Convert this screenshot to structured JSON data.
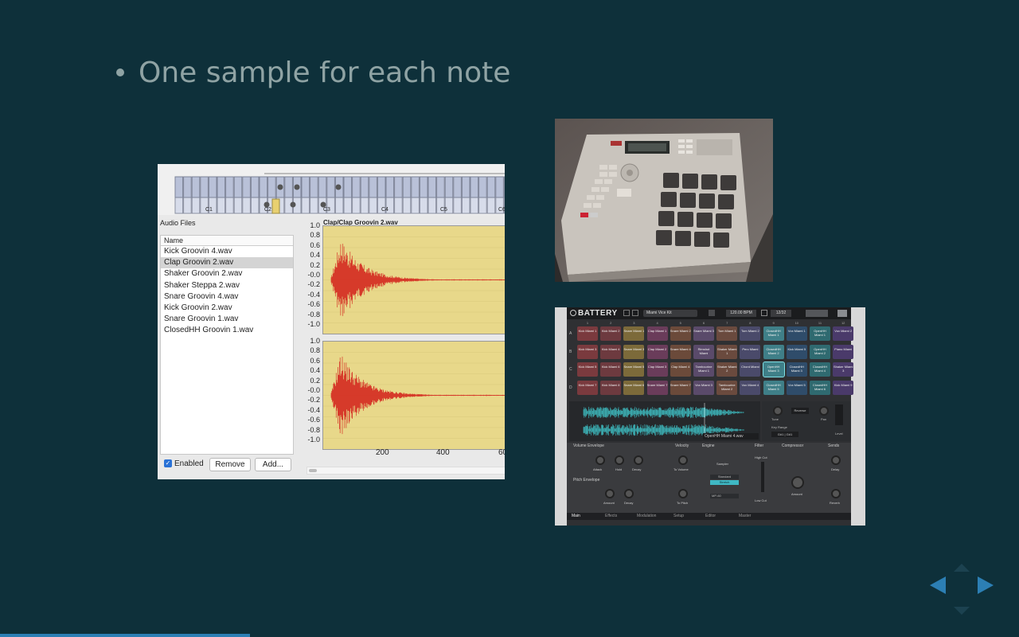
{
  "slide": {
    "bullet_text": "One sample for each note"
  },
  "sampler": {
    "keyboard_labels": [
      "C1",
      "C2",
      "C3",
      "C4",
      "C5",
      "C6"
    ],
    "audio_files_label": "Audio Files",
    "name_header": "Name",
    "files": [
      "Kick Groovin 4.wav",
      "Clap Groovin 2.wav",
      "Shaker Groovin 2.wav",
      "Shaker Steppa 2.wav",
      "Snare Groovin 4.wav",
      "Kick Groovin 2.wav",
      "Snare Groovin 1.wav",
      "ClosedHH Groovin 1.wav"
    ],
    "selected_file_index": 1,
    "enabled_label": "Enabled",
    "enabled_checked": true,
    "remove_label": "Remove",
    "add_label": "Add...",
    "waveform_title": "Clap/Clap Groovin 2.wav",
    "y_ticks": [
      "1.0",
      "0.8",
      "0.6",
      "0.4",
      "0.2",
      "-0.0",
      "-0.2",
      "-0.4",
      "-0.6",
      "-0.8",
      "-1.0"
    ],
    "x_ticks": [
      "200",
      "400",
      "60"
    ],
    "wave_color": "#d63a2a",
    "wave_bg": "#e8d88a"
  },
  "battery": {
    "logo": "BATTERY",
    "kit_name": "Miami Vice Kit",
    "bpm": "120.00 BPM",
    "page": "12/32",
    "row_labels": [
      "A",
      "B",
      "C",
      "D"
    ],
    "col_numbers": [
      "1",
      "2",
      "3",
      "4",
      "5",
      "6",
      "7",
      "8",
      "9",
      "10",
      "11",
      "12"
    ],
    "rows": [
      [
        "Kick Miami 1",
        "Kick Miami 2",
        "Snare Miami 1",
        "Clap Miami 1",
        "Snare Miami 2",
        "Snare Miami 3",
        "Tom Miami 1",
        "Tom Miami 2",
        "ClosedHH Miami 1",
        "Vox Miami 1",
        "OpenHH Miami 1",
        "Vox Miami 2"
      ],
      [
        "Kick Miami 3",
        "Kick Miami 4",
        "Snare Miami 3",
        "Clap Miami 2",
        "Snare Miami 4",
        "Rimshot Miami",
        "Shaker Miami 1",
        "Perc Miami",
        "ClosedHH Miami 2",
        "Kick Miami 5",
        "OpenHH Miami 2",
        "Piano Miami"
      ],
      [
        "Kick Miami 5",
        "Kick Miami 6",
        "Snare Miami 5",
        "Clap Miami 3",
        "Clap Miami 4",
        "Tambourine Miami 1",
        "Shaker Miami 2",
        "Chord Miami",
        "OpenHH Miami 3",
        "ClosedHH Miami 3",
        "ClosedHH Miami 4",
        "Shaker Miami 3"
      ],
      [
        "Kick Miami 7",
        "Kick Miami 8",
        "Snare Miami 6",
        "Snare Miami 7",
        "Snare Miami 7",
        "Vox Miami 3",
        "Tambourine Miami 2",
        "Vox Miami 4",
        "ClosedHH Miami 5",
        "Vox Miami 5",
        "ClosedHH Miami 6",
        "Kick Miami 9"
      ]
    ],
    "selected_cell": "OpenHH Miami 3",
    "sample_name": "OpenHH Miami 4.wav",
    "sections": {
      "volume_envelope": "Volume Envelope",
      "velocity": "Velocity",
      "engine": "Engine",
      "filter": "Filter",
      "compressor": "Compressor",
      "sends": "Sends",
      "pitch_envelope": "Pitch Envelope"
    },
    "knobs": {
      "attack": "Attack",
      "hold": "Hold",
      "decay": "Decay",
      "to_volume": "To Volume",
      "to_pitch": "To Pitch",
      "amount": "Amount",
      "decay2": "Decay",
      "high_cut": "High Cut",
      "low_cut": "Low Cut",
      "comp_amount": "Amount",
      "delay": "Delay",
      "reverb": "Reverb",
      "tune": "Tune",
      "pan": "Pan",
      "reverse": "Reverse",
      "key_range": "Key Range",
      "key_range_value": "G#1 | G#1",
      "level": "Level"
    },
    "engine": {
      "sampler": "Sampler",
      "standard": "Standard",
      "stretch": "Stretch",
      "mode": "MP-60"
    },
    "tabs": [
      "Main",
      "Effects",
      "Modulation",
      "Setup",
      "Editor",
      "Master"
    ]
  },
  "colors": {
    "background": "#0e303a",
    "title": "#8fa3a4",
    "nav_arrow": "#2c7fb4"
  }
}
